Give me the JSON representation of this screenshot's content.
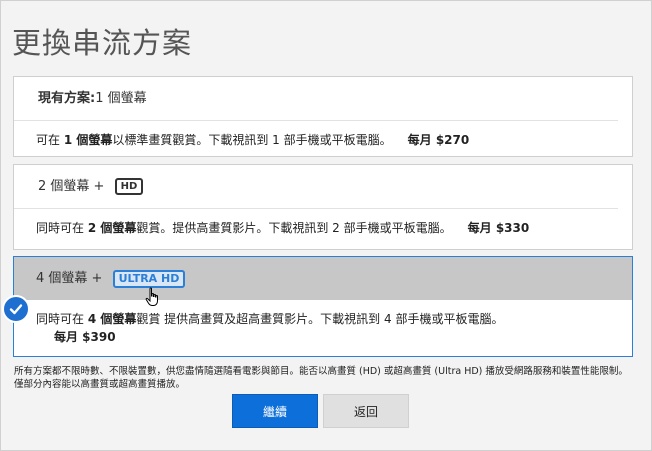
{
  "page": {
    "title": "更換串流方案"
  },
  "plans": [
    {
      "current_label": "現有方案:",
      "screens": "1 個螢幕",
      "desc_prefix": "可在 ",
      "desc_bold": "1 個螢幕",
      "desc_rest": "以標準畫質觀賞。下載視訊到 1 部手機或平板電腦。",
      "price": "每月 $270"
    },
    {
      "screens": "2 個螢幕 +",
      "badge": "HD",
      "desc_prefix": "同時可在 ",
      "desc_bold": "2 個螢幕",
      "desc_rest": "觀賞。提供高畫質影片。下載視訊到 2 部手機或平板電腦。",
      "price": "每月 $330"
    },
    {
      "screens": "4 個螢幕 +",
      "badge": "ULTRA HD",
      "desc_prefix": "同時可在 ",
      "desc_bold": "4 個螢幕",
      "desc_rest": "觀賞 提供高畫質及超高畫質影片。下載視訊到 4 部手機或平板電腦。",
      "price": "每月 $390",
      "selected": true
    }
  ],
  "footnote": "所有方案都不限時數、不限裝置數，供您盡情隨選隨看電影與節目。能否以高畫質 (HD) 或超高畫質 (Ultra HD) 播放受網路服務和裝置性能限制。僅部分內容能以高畫質或超高畫質播放。",
  "buttons": {
    "continue": "繼續",
    "back": "返回"
  },
  "colors": {
    "accent": "#0d6fd9",
    "selected_border": "#2b7fd6"
  },
  "icons": {
    "selected": "checkmark-icon",
    "cursor": "hand-cursor-icon"
  }
}
